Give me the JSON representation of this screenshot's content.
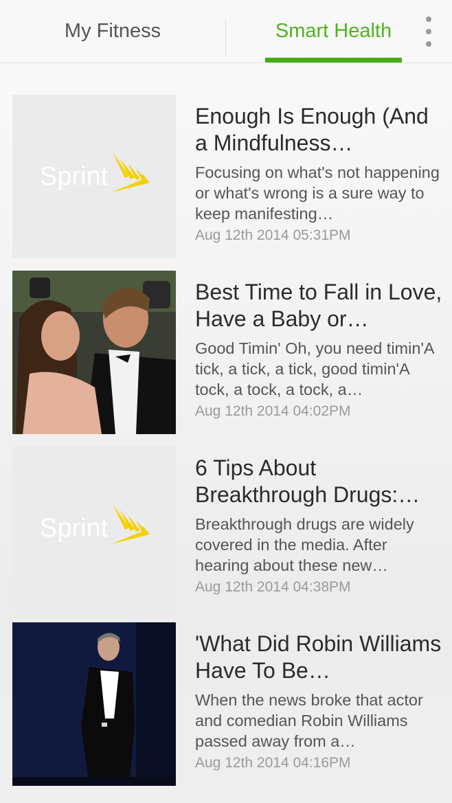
{
  "tabs": {
    "fitness": "My Fitness",
    "health": "Smart Health",
    "active_color": "#45ad18"
  },
  "articles": [
    {
      "title": "Enough Is Enough (And a Mindfulness…",
      "snippet": "Focusing on what's not happening or what's wrong is a sure way to keep manifesting…",
      "date": "Aug 12th 2014 05:31PM",
      "image": "sprint-placeholder",
      "logo_text": "Sprint"
    },
    {
      "title": "Best Time to Fall in Love, Have a Baby or…",
      "snippet": "Good Timin' Oh, you need timin'A tick, a tick, a tick, good timin'A tock, a tock, a tock, a…",
      "date": "Aug 12th 2014 04:02PM",
      "image": "couple-photo"
    },
    {
      "title": "6 Tips About Breakthrough Drugs:…",
      "snippet": "Breakthrough drugs are widely covered in the media. After hearing about these new…",
      "date": "Aug 12th 2014 04:38PM",
      "image": "sprint-placeholder",
      "logo_text": "Sprint"
    },
    {
      "title": "'What Did Robin Williams Have To Be…",
      "snippet": "When the news broke that actor and comedian Robin Williams passed away from a…",
      "date": "Aug 12th 2014 04:16PM",
      "image": "man-on-stage-photo"
    }
  ]
}
